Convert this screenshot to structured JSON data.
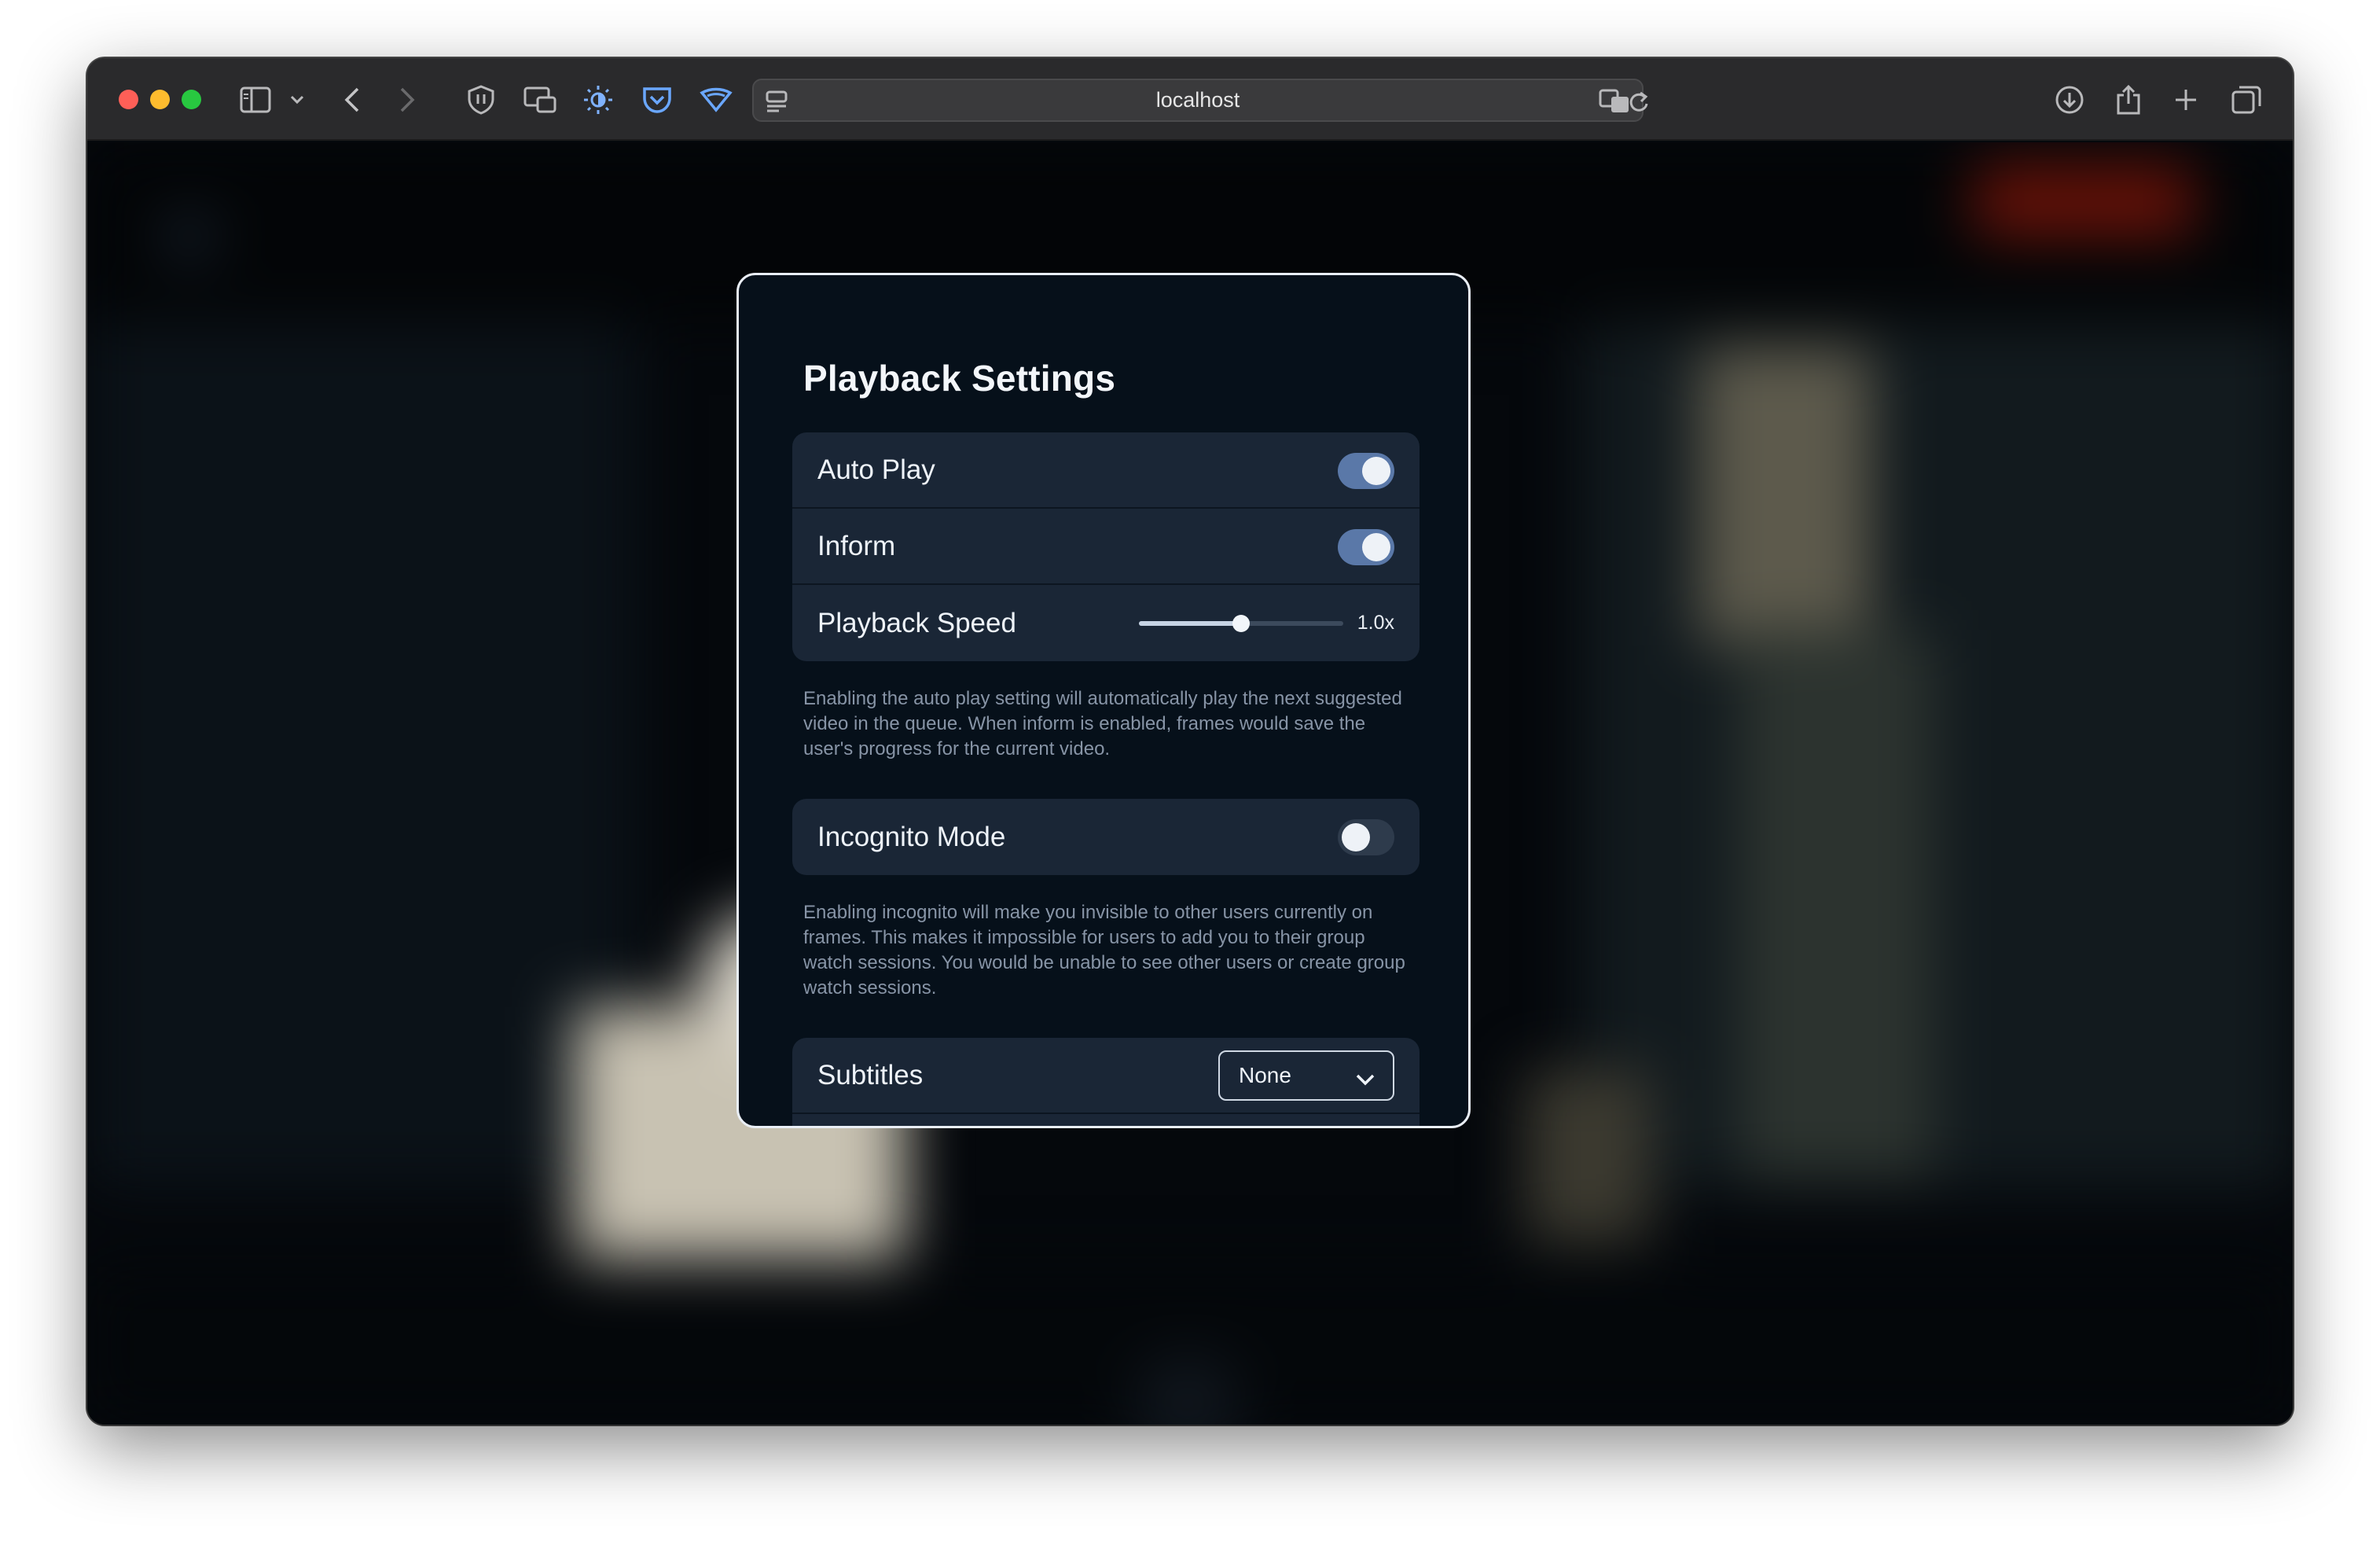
{
  "browser": {
    "url": "localhost",
    "icons": [
      "sidebar-icon",
      "chevron-down-icon",
      "back-icon",
      "forward-icon",
      "shield-icon",
      "picture-in-picture-icon",
      "brightness-icon",
      "pocket-icon",
      "wifi-shield-icon",
      "reader-icon",
      "translate-icon",
      "reload-icon",
      "download-icon",
      "share-icon",
      "new-tab-icon",
      "tabs-icon"
    ]
  },
  "modal": {
    "title": "Playback Settings",
    "auto_play": {
      "label": "Auto Play",
      "enabled": true
    },
    "inform": {
      "label": "Inform",
      "enabled": true
    },
    "playback_speed": {
      "label": "Playback Speed",
      "value": "1.0x",
      "fraction": 0.5
    },
    "playback_note": "Enabling the auto play setting will automatically play the next suggested video in the queue. When inform is enabled, frames would save the user's progress for the current video.",
    "incognito": {
      "label": "Incognito Mode",
      "enabled": false
    },
    "incognito_note": "Enabling incognito will make you invisible to other users currently on frames. This makes it impossible for users to add you to their group watch sessions. You would be unable to see other users or create group watch sessions.",
    "subtitles": {
      "label": "Subtitles",
      "selected": "None"
    }
  },
  "colors": {
    "accent": "#5a78a8",
    "modal_bg": "#06101a",
    "card_bg": "#1a2636"
  }
}
